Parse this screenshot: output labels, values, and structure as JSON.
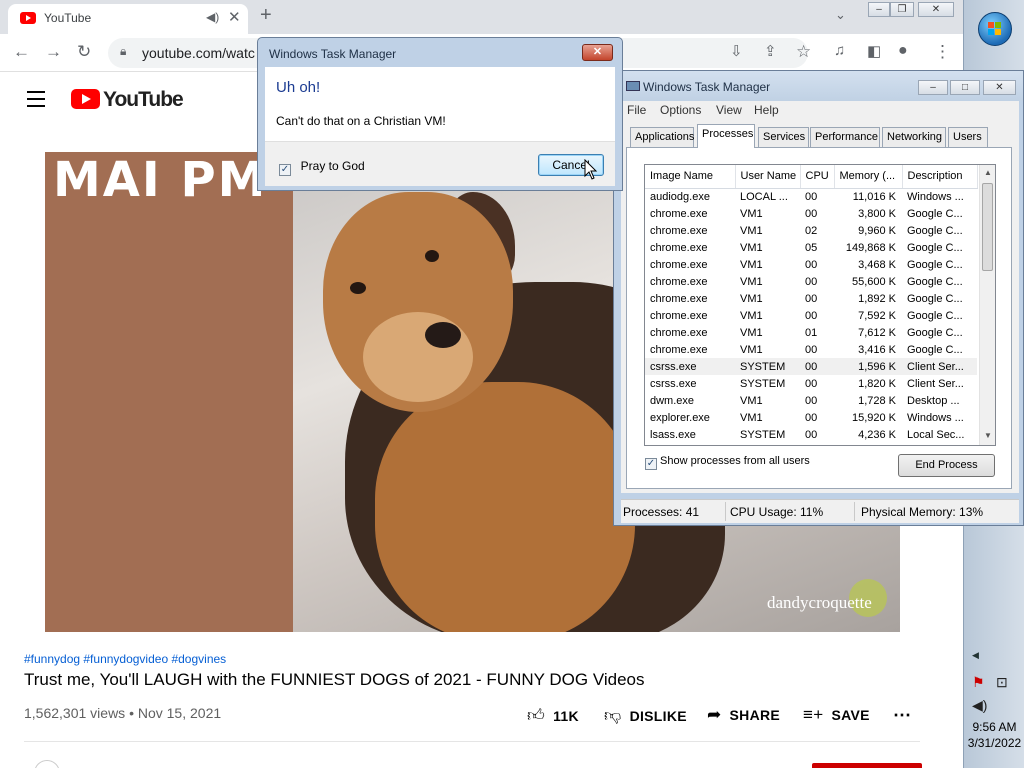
{
  "browser": {
    "tab_title": "YouTube",
    "url": "youtube.com/watc",
    "newtab_glyph": "+",
    "close_glyph": "✕"
  },
  "youtube": {
    "logo_text": "YouTube",
    "video_overlay_text": "MAI PM",
    "watermark": "dandycroquette",
    "hashtags": "#funnydog #funnydogvideo #dogvines",
    "title": "Trust me, You'll LAUGH with the FUNNIEST DOGS of 2021 - FUNNY DOG Videos",
    "meta": "1,562,301 views • Nov 15, 2021",
    "actions": {
      "like": "11K",
      "dislike": "DISLIKE",
      "share": "SHARE",
      "save": "SAVE"
    }
  },
  "taskbar": {
    "time": "9:56 AM",
    "date": "3/31/2022"
  },
  "task_manager": {
    "title": "Windows Task Manager",
    "menu": [
      "File",
      "Options",
      "View",
      "Help"
    ],
    "tabs": [
      "Applications",
      "Processes",
      "Services",
      "Performance",
      "Networking",
      "Users"
    ],
    "active_tab": "Processes",
    "columns": [
      "Image Name",
      "User Name",
      "CPU",
      "Memory (...",
      "Description"
    ],
    "rows": [
      [
        "audiodg.exe",
        "LOCAL ...",
        "00",
        "11,016 K",
        "Windows ..."
      ],
      [
        "chrome.exe",
        "VM1",
        "00",
        "3,800 K",
        "Google C..."
      ],
      [
        "chrome.exe",
        "VM1",
        "02",
        "9,960 K",
        "Google C..."
      ],
      [
        "chrome.exe",
        "VM1",
        "05",
        "149,868 K",
        "Google C..."
      ],
      [
        "chrome.exe",
        "VM1",
        "00",
        "3,468 K",
        "Google C..."
      ],
      [
        "chrome.exe",
        "VM1",
        "00",
        "55,600 K",
        "Google C..."
      ],
      [
        "chrome.exe",
        "VM1",
        "00",
        "1,892 K",
        "Google C..."
      ],
      [
        "chrome.exe",
        "VM1",
        "00",
        "7,592 K",
        "Google C..."
      ],
      [
        "chrome.exe",
        "VM1",
        "01",
        "7,612 K",
        "Google C..."
      ],
      [
        "chrome.exe",
        "VM1",
        "00",
        "3,416 K",
        "Google C..."
      ],
      [
        "csrss.exe",
        "SYSTEM",
        "00",
        "1,596 K",
        "Client Ser..."
      ],
      [
        "csrss.exe",
        "SYSTEM",
        "00",
        "1,820 K",
        "Client Ser..."
      ],
      [
        "dwm.exe",
        "VM1",
        "00",
        "1,728 K",
        "Desktop ..."
      ],
      [
        "explorer.exe",
        "VM1",
        "00",
        "15,920 K",
        "Windows ..."
      ],
      [
        "lsass.exe",
        "SYSTEM",
        "00",
        "4,236 K",
        "Local Sec..."
      ]
    ],
    "selected_row": 10,
    "show_all_label": "Show processes from all users",
    "show_all_checked": true,
    "end_process_label": "End Process",
    "status": {
      "processes": "Processes: 41",
      "cpu": "CPU Usage: 11%",
      "memory": "Physical Memory: 13%"
    }
  },
  "dialog": {
    "title": "Windows Task Manager",
    "heading": "Uh oh!",
    "message": "Can't do that on a Christian VM!",
    "checkbox_label": "Pray to God",
    "checkbox_checked": true,
    "cancel_label": "Cancel"
  }
}
